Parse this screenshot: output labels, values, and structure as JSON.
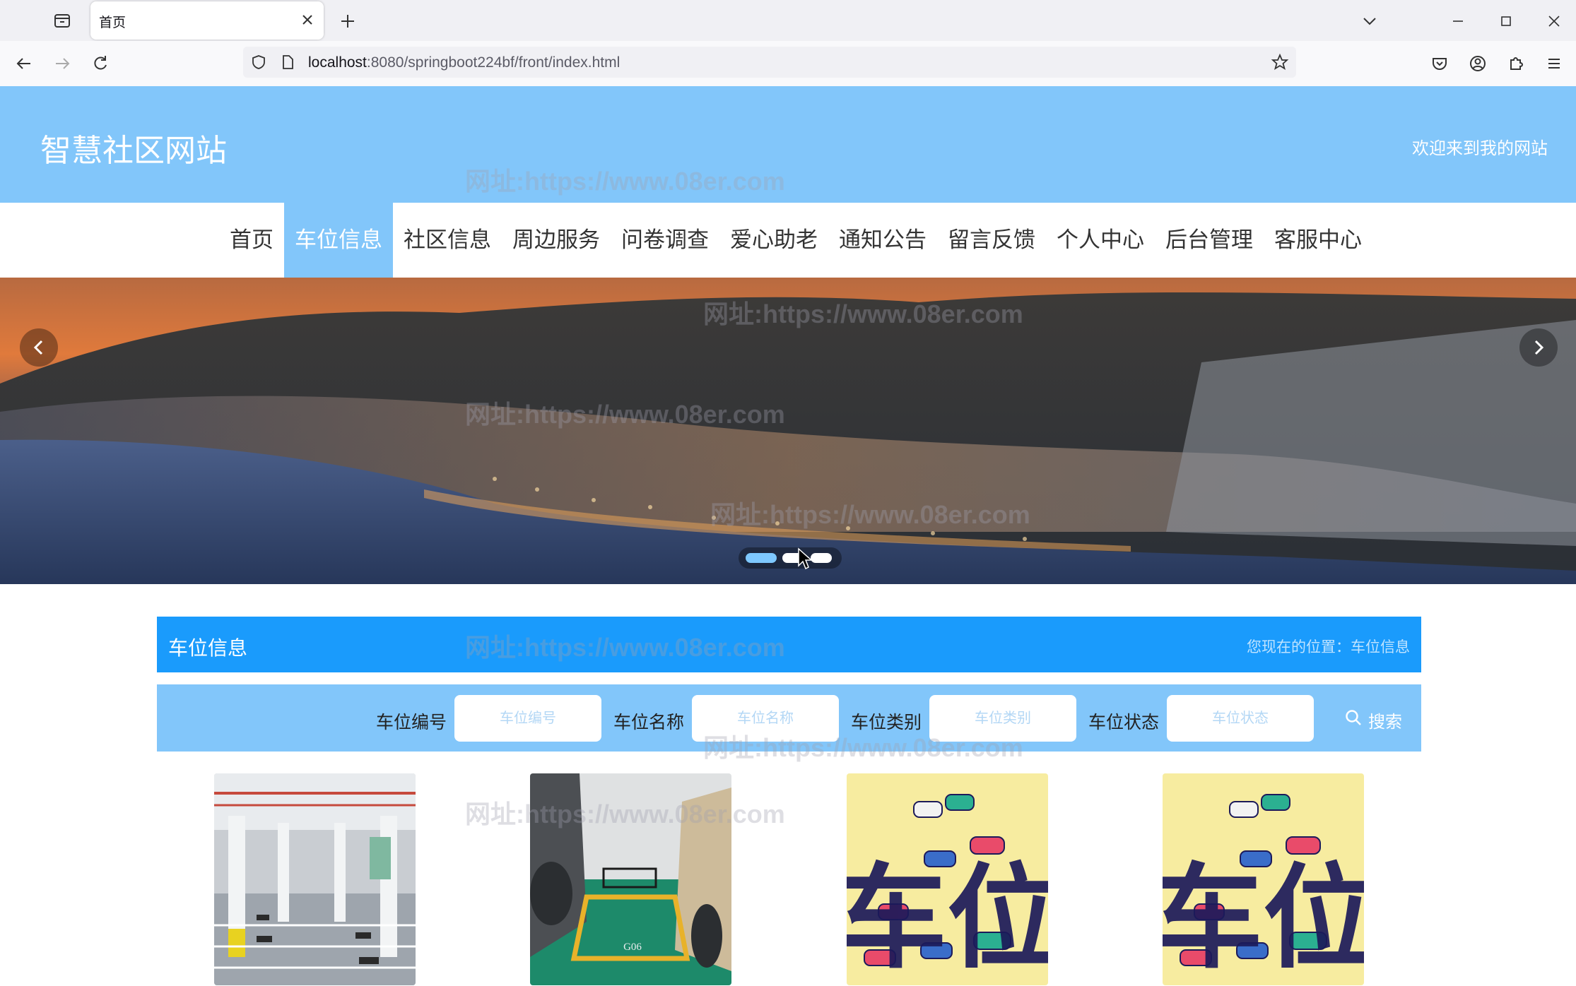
{
  "browser": {
    "tab_title": "首页",
    "url_host": "localhost",
    "url_rest": ":8080/springboot224bf/front/index.html"
  },
  "site": {
    "title": "智慧社区网站",
    "welcome": "欢迎来到我的网站"
  },
  "nav": {
    "items": [
      "首页",
      "车位信息",
      "社区信息",
      "周边服务",
      "问卷调查",
      "爱心助老",
      "通知公告",
      "留言反馈",
      "个人中心",
      "后台管理",
      "客服中心"
    ],
    "active_index": 1
  },
  "section": {
    "title": "车位信息",
    "breadcrumb": "您现在的位置：车位信息"
  },
  "search": {
    "fields": [
      {
        "label": "车位编号",
        "placeholder": "车位编号"
      },
      {
        "label": "车位名称",
        "placeholder": "车位名称"
      },
      {
        "label": "车位类别",
        "placeholder": "车位类别"
      },
      {
        "label": "车位状态",
        "placeholder": "车位状态"
      }
    ],
    "button": "搜索"
  },
  "watermark": "网址:https://www.08er.com",
  "colors": {
    "header_bg": "#82c6fa",
    "section_bar": "#1a9bfc",
    "nav_active": "#82c6fa"
  },
  "carousel": {
    "slide_count": 3,
    "active_slide": 1
  },
  "cards": [
    {
      "image": "parking-garage-photo"
    },
    {
      "image": "parking-space-g06-photo",
      "plate": "G06"
    },
    {
      "image": "parking-cartoon-graphic",
      "text": "车位"
    },
    {
      "image": "parking-cartoon-graphic",
      "text": "车位"
    }
  ]
}
